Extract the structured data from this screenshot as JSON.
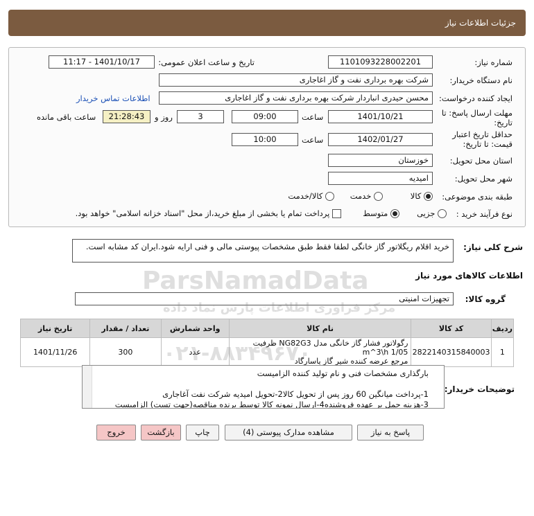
{
  "header": {
    "title": "جزئیات اطلاعات نیاز"
  },
  "fields": {
    "need_number_label": "شماره نیاز:",
    "need_number": "1101093228002201",
    "announce_label": "تاریخ و ساعت اعلان عمومی:",
    "announce_value": "1401/10/17 - 11:17",
    "buyer_org_label": "نام دستگاه خریدار:",
    "buyer_org": "شرکت بهره برداری نفت و گاز اغاجاری",
    "requester_label": "ایجاد کننده درخواست:",
    "requester": "محسن حیدری انباردار شرکت بهره برداری نفت و گاز اغاجاری",
    "contact_link": "اطلاعات تماس خریدار",
    "deadline_label": "مهلت ارسال پاسخ: تا تاریخ:",
    "deadline_date": "1401/10/21",
    "time_word": "ساعت",
    "deadline_time": "09:00",
    "days_count": "3",
    "days_word": "روز و",
    "remaining_time": "21:28:43",
    "remaining_word": "ساعت باقی مانده",
    "validity_label": "حداقل تاریخ اعتبار قیمت: تا تاریخ:",
    "validity_date": "1402/01/27",
    "validity_time": "10:00",
    "province_label": "استان محل تحویل:",
    "province": "خوزستان",
    "city_label": "شهر محل تحویل:",
    "city": "امیدیه",
    "category_label": "طبقه بندی موضوعی:",
    "cat_goods": "کالا",
    "cat_service": "خدمت",
    "cat_both": "کالا/خدمت",
    "process_label": "نوع فرآیند خرید :",
    "proc_minor": "جزیی",
    "proc_medium": "متوسط",
    "payment_note": "پرداخت تمام یا بخشی از مبلغ خرید،از محل \"اسناد خزانه اسلامی\" خواهد بود."
  },
  "description": {
    "label": "شرح کلی نیاز:",
    "text": "خرید اقلام ریگلاتور گاز خانگی لطفا فقط طبق مشخصات پیوستی مالی و فنی ارایه شود.ایران کد مشابه است."
  },
  "goods": {
    "section_title": "اطلاعات کالاهای مورد نیاز",
    "group_label": "گروه کالا:",
    "group_value": "تجهیزات امنیتی",
    "columns": [
      "ردیف",
      "کد کالا",
      "نام کالا",
      "واحد شمارش",
      "تعداد / مقدار",
      "تاریخ نیاز"
    ],
    "rows": [
      {
        "row": "1",
        "code": "2822140315840003",
        "name_line1": "رگولاتور فشار گاز خانگی مدل NG82G3 ظرفیت m^3\\h 1/05",
        "name_line2": "مرجع عرضه کننده شیر گاز پاسارگاد",
        "unit": "عدد",
        "qty": "300",
        "date": "1401/11/26"
      }
    ]
  },
  "buyer_notes": {
    "label": "توضیحات خریدار:",
    "lines": [
      "بارگذاری مشخصات فنی و نام تولید کننده الزامیست",
      "",
      "1-پرداخت میانگین 60 روز پس از تحویل کالا2-تحویل امیدیه شرکت نفت آغاجاری",
      "3-هزینه حمل بر عهده فروشنده4-ارسال نمونه کالا توسط برنده مناقصه(جهت تست) الزامیست"
    ]
  },
  "buttons": {
    "reply": "پاسخ به نیاز",
    "attachments": "مشاهده مدارک پیوستی (4)",
    "print": "چاپ",
    "back": "بازگشت",
    "exit": "خروج"
  },
  "watermark": {
    "text1": "ParsNamadData",
    "text2": "۰۲۱-۸۸۳۴۹۶۷۰",
    "text3": "مرکز فراوری اطلاعات پارس نماد داده"
  },
  "colors": {
    "header_bg": "#7b5b40",
    "exit_button": "#f5c6c6",
    "remaining_bg": "#f5f0c4"
  }
}
